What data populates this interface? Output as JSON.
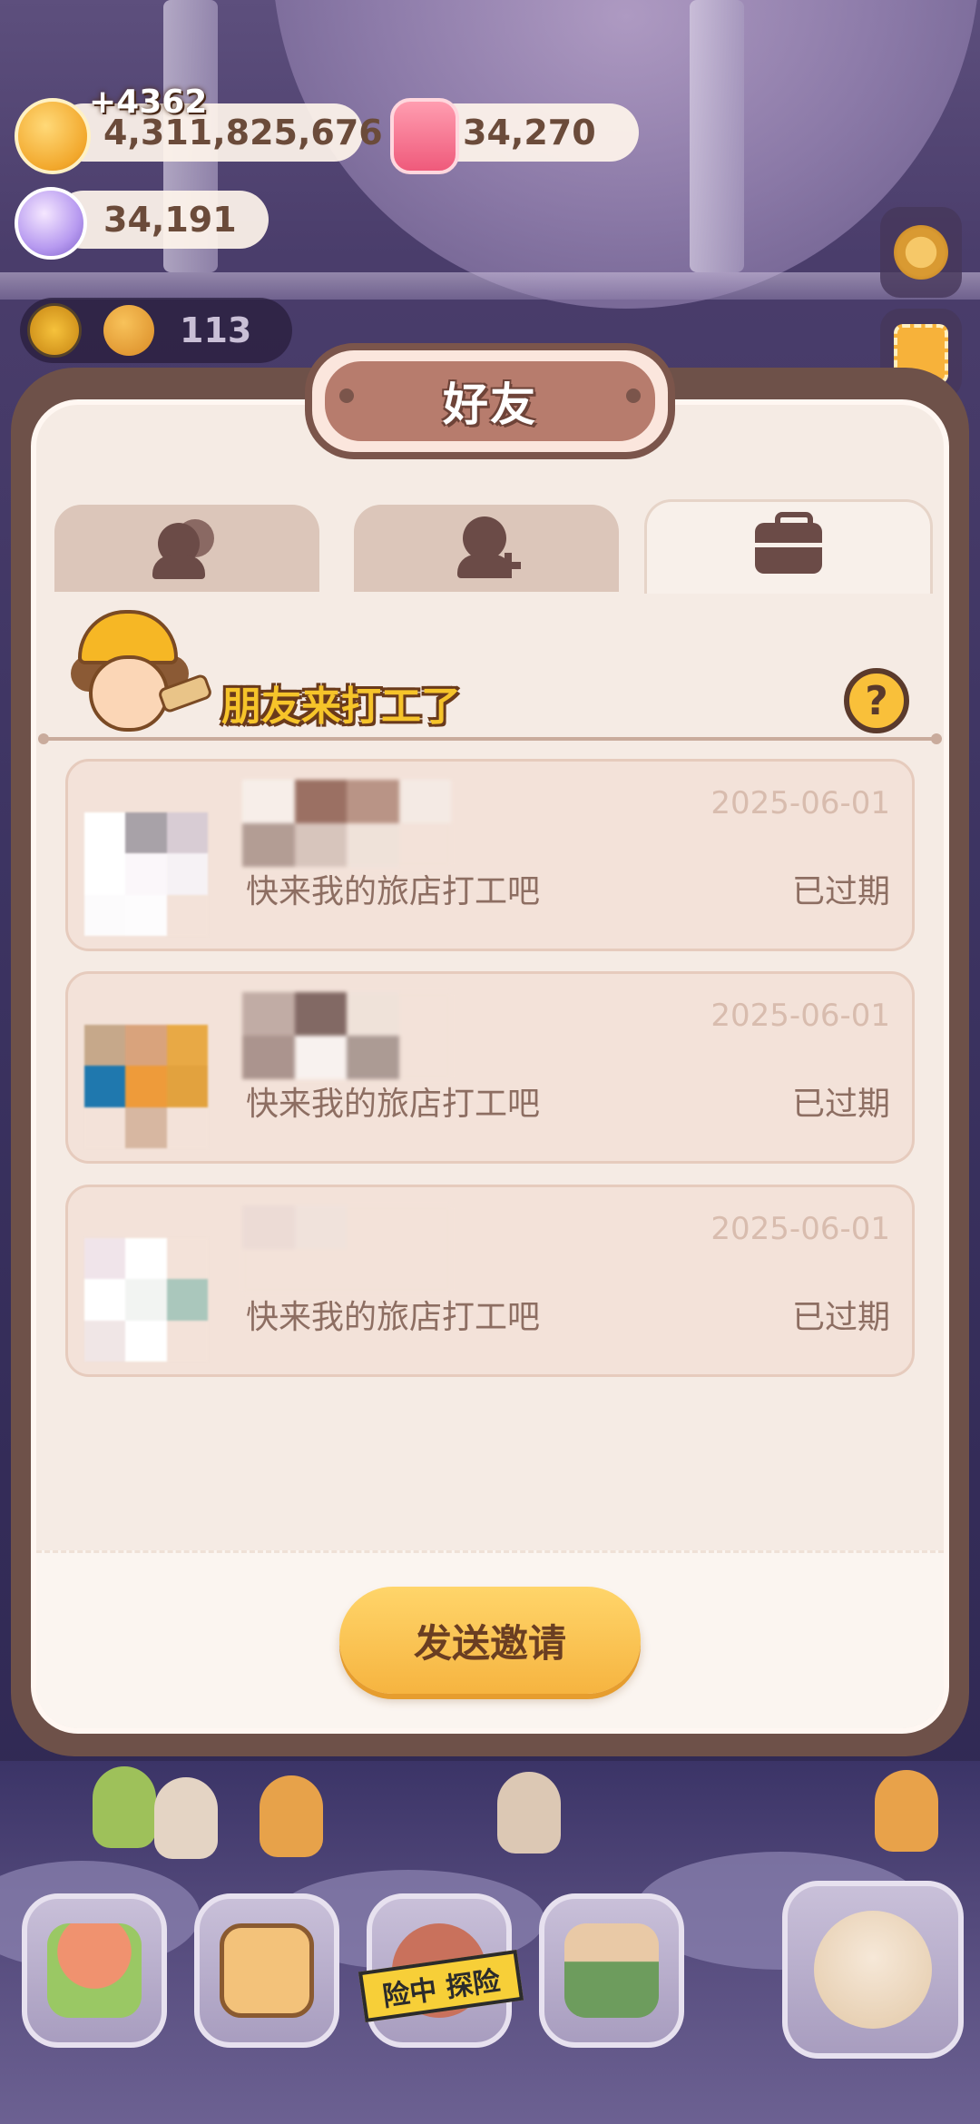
{
  "resources": {
    "coin_bonus": "+4362",
    "coins": "4,311,825,676",
    "candles": "34,270",
    "gems": "34,191",
    "level_count": "113"
  },
  "dialog": {
    "title": "好友",
    "tabs": [
      {
        "icon": "friends-icon",
        "active": false
      },
      {
        "icon": "add-friend-icon",
        "active": false
      },
      {
        "icon": "briefcase-icon",
        "active": true
      }
    ],
    "banner_text": "朋友来打工了",
    "help_label": "?",
    "invites": [
      {
        "date": "2025-06-01",
        "message": "快来我的旅店打工吧",
        "status": "已过期"
      },
      {
        "date": "2025-06-01",
        "message": "快来我的旅店打工吧",
        "status": "已过期"
      },
      {
        "date": "2025-06-01",
        "message": "快来我的旅店打工吧",
        "status": "已过期"
      }
    ],
    "send_button": "发送邀请"
  },
  "bottom_nav": {
    "caution_label": "险中 探险"
  },
  "colors": {
    "frame": "#6e5149",
    "panel": "#f5ebe4",
    "accent": "#f6b440",
    "text_brown": "#8d6e62"
  }
}
